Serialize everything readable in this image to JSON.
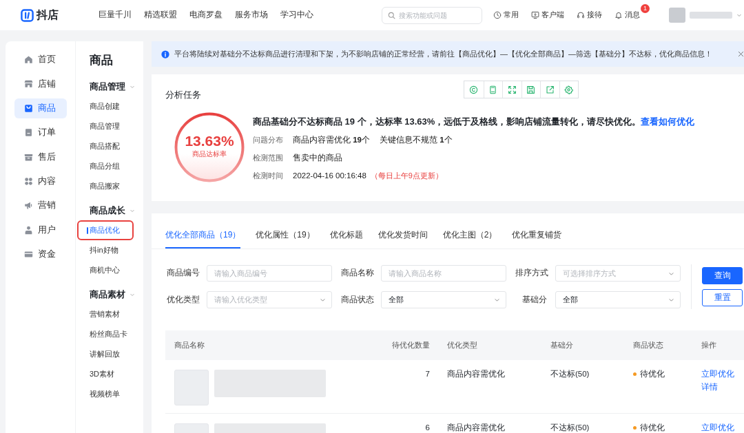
{
  "top_bar": {
    "logo": "抖店",
    "nav": [
      "巨量千川",
      "精选联盟",
      "电商罗盘",
      "服务市场",
      "学习中心"
    ],
    "search": {
      "placeholder": "搜索功能或问题"
    },
    "actions": [
      {
        "label": "常用"
      },
      {
        "label": "客户端"
      },
      {
        "label": "接待"
      },
      {
        "label": "消息",
        "badge": "1"
      }
    ]
  },
  "sidebar": {
    "items": [
      {
        "label": "首页",
        "selected": false
      },
      {
        "label": "店铺",
        "selected": false
      },
      {
        "label": "商品",
        "selected": true
      },
      {
        "label": "订单",
        "selected": false
      },
      {
        "label": "售后",
        "selected": false
      },
      {
        "label": "内容",
        "selected": false
      },
      {
        "label": "营销",
        "selected": false
      },
      {
        "label": "用户",
        "selected": false
      },
      {
        "label": "资金",
        "selected": false
      }
    ]
  },
  "subnav": {
    "title": "商品",
    "groups": [
      {
        "title": "商品管理",
        "expanded": true,
        "items": [
          {
            "label": "商品创建",
            "selected": false,
            "highlighted": false
          },
          {
            "label": "商品管理",
            "selected": false,
            "highlighted": false
          },
          {
            "label": "商品搭配",
            "selected": false,
            "highlighted": false
          },
          {
            "label": "商品分组",
            "selected": false,
            "highlighted": false
          },
          {
            "label": "商品搬家",
            "selected": false,
            "highlighted": false
          }
        ]
      },
      {
        "title": "商品成长",
        "expanded": true,
        "items": [
          {
            "label": "商品优化",
            "selected": true,
            "highlighted": true
          },
          {
            "label": "抖in好物",
            "selected": false,
            "highlighted": false
          },
          {
            "label": "商机中心",
            "selected": false,
            "highlighted": false
          }
        ]
      },
      {
        "title": "商品素材",
        "expanded": true,
        "items": [
          {
            "label": "营销素材",
            "selected": false,
            "highlighted": false
          },
          {
            "label": "粉丝商品卡",
            "selected": false,
            "highlighted": false
          },
          {
            "label": "讲解回放",
            "selected": false,
            "highlighted": false
          },
          {
            "label": "3D素材",
            "selected": false,
            "highlighted": false
          },
          {
            "label": "视频榜单",
            "selected": false,
            "highlighted": false
          }
        ]
      }
    ]
  },
  "notice": {
    "text": "平台将陆续对基础分不达标商品进行清理和下架，为不影响店铺的正常经营，请前往【商品优化】—【优化全部商品】—筛选【基础分】不达标，优化商品信息！",
    "closable": true
  },
  "analysis": {
    "title": "分析任务",
    "rate": {
      "value": "13.63%",
      "label": "商品达标率"
    },
    "summary": "商品基础分不达标商品 19 个，达标率 13.63%，远低于及格线，影响店铺流量转化，请尽快优化。",
    "summary_link": "查看如何优化",
    "details": [
      {
        "label": "问题分布",
        "values": [
          "商品内容需优化 **19**个",
          "关键信息不规范 **1**个"
        ]
      },
      {
        "label": "检测范围",
        "values": [
          "售卖中的商品"
        ]
      },
      {
        "label": "检测时间",
        "values": [
          "2022-04-16 00:16:48"
        ],
        "note": "（每日上午9点更新）"
      }
    ]
  },
  "tabs": [
    {
      "label": "优化全部商品（19）",
      "selected": true
    },
    {
      "label": "优化属性（19）",
      "selected": false
    },
    {
      "label": "优化标题",
      "selected": false
    },
    {
      "label": "优化发货时间",
      "selected": false
    },
    {
      "label": "优化主图（2）",
      "selected": false
    },
    {
      "label": "优化重复铺货",
      "selected": false
    }
  ],
  "filters": [
    {
      "label": "商品编号",
      "kind": "input",
      "placeholder": "请输入商品编号"
    },
    {
      "label": "商品名称",
      "kind": "input",
      "placeholder": "请输入商品名称"
    },
    {
      "label": "排序方式",
      "kind": "select",
      "placeholder": "可选择排序方式"
    },
    {
      "label": "优化类型",
      "kind": "select",
      "placeholder": "请输入优化类型"
    },
    {
      "label": "商品状态",
      "kind": "select",
      "value": "全部"
    },
    {
      "label": "基础分",
      "kind": "select",
      "value": "全部"
    }
  ],
  "filter_buttons": [
    {
      "label": "查询",
      "kind": "primary"
    },
    {
      "label": "重置",
      "kind": "secondary"
    }
  ],
  "table": {
    "columns": [
      "商品名称",
      "待优化数量",
      "优化类型",
      "基础分",
      "商品状态",
      "操作"
    ],
    "rows": [
      {
        "count": "7",
        "type": "商品内容需优化",
        "score": "不达标(50)",
        "status": {
          "text": "待优化",
          "color": "#f59a23"
        },
        "actions": [
          "立即优化",
          "详情"
        ]
      },
      {
        "count": "6",
        "type": "商品内容需优化",
        "score": "不达标(50)",
        "status": {
          "text": "待优化",
          "color": "#f59a23"
        },
        "actions": [
          "立即优化"
        ]
      }
    ]
  }
}
